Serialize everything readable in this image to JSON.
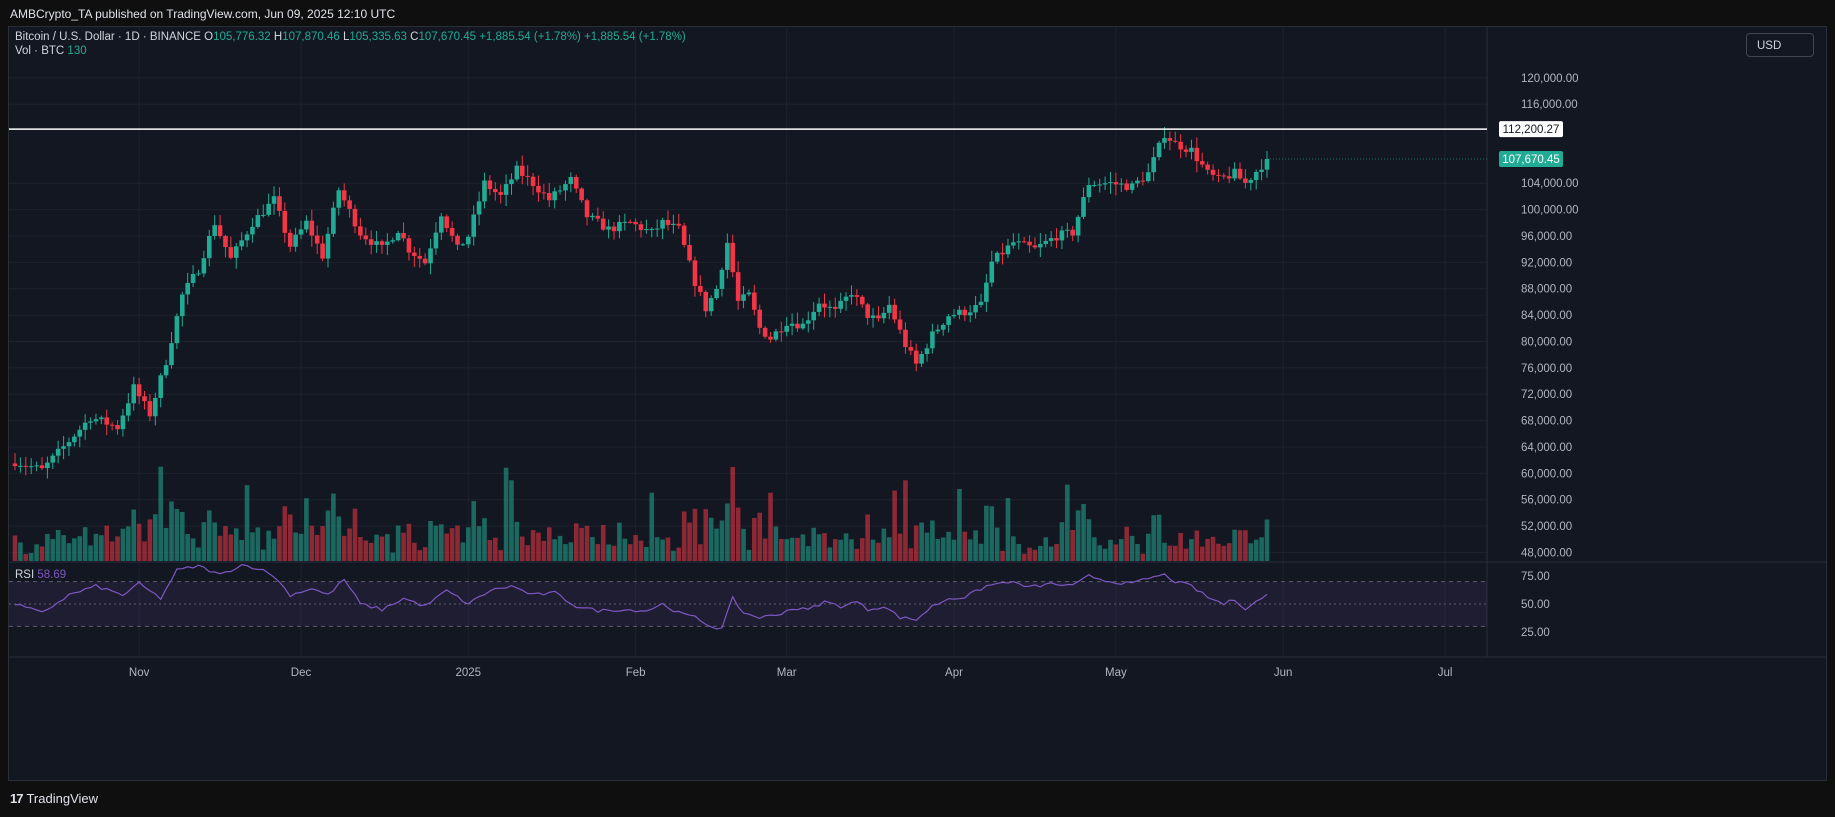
{
  "topbar": {
    "text": "AMBCrypto_TA published on TradingView.com, Jun 09, 2025 12:10 UTC"
  },
  "legend": {
    "title": "Bitcoin / U.S. Dollar · 1D · BINANCE",
    "o_label": "O",
    "o_value": "105,776.32",
    "h_label": "H",
    "h_value": "107,870.46",
    "l_label": "L",
    "l_value": "105,335.63",
    "c_label": "C",
    "c_value": "107,670.45",
    "change1": "+1,885.54 (+1.78%)",
    "change2": "+1,885.54 (+1.78%)",
    "vol_label": "Vol · BTC",
    "vol_value": "130",
    "rsi_label": "RSI",
    "rsi_value": "58.69"
  },
  "currency_button": "USD",
  "footer": {
    "logo_text": "TradingView",
    "logo_mark": "17"
  },
  "colors": {
    "up": "#22ab94",
    "down": "#f23645",
    "rsi": "#7e57c2",
    "bg": "#131722",
    "grid": "#1e222d"
  },
  "chart_data": [
    {
      "type": "candlestick",
      "title": "Bitcoin / U.S. Dollar · 1D · BINANCE",
      "y_axis_ticks": [
        120000,
        116000,
        104000,
        100000,
        96000,
        92000,
        88000,
        84000,
        80000,
        76000,
        72000,
        68000,
        64000,
        60000,
        56000,
        52000,
        48000
      ],
      "y_axis_tick_labels": [
        "120,000.00",
        "116,000.00",
        "104,000.00",
        "100,000.00",
        "96,000.00",
        "92,000.00",
        "88,000.00",
        "84,000.00",
        "80,000.00",
        "76,000.00",
        "72,000.00",
        "68,000.00",
        "64,000.00",
        "60,000.00",
        "56,000.00",
        "52,000.00",
        "48,000.00"
      ],
      "ylim": [
        46700,
        127700
      ],
      "x_axis_labels": [
        {
          "label": "Nov",
          "day": 23
        },
        {
          "label": "Dec",
          "day": 53
        },
        {
          "label": "2025",
          "day": 84
        },
        {
          "label": "Feb",
          "day": 115
        },
        {
          "label": "Mar",
          "day": 143
        },
        {
          "label": "Apr",
          "day": 174
        },
        {
          "label": "May",
          "day": 204
        },
        {
          "label": "Jun",
          "day": 235
        },
        {
          "label": "Jul",
          "day": 265
        }
      ],
      "horizontal_line": {
        "value": 112200.27,
        "label": "112,200.27",
        "color": "#ffffff"
      },
      "last_price": {
        "value": 107670.45,
        "label": "107,670.45"
      },
      "anchors": [
        [
          0,
          61800
        ],
        [
          5,
          60500
        ],
        [
          9,
          64000
        ],
        [
          14,
          68500
        ],
        [
          19,
          67000
        ],
        [
          22,
          73000
        ],
        [
          25,
          69000
        ],
        [
          28,
          77000
        ],
        [
          31,
          87000
        ],
        [
          34,
          91000
        ],
        [
          37,
          98000
        ],
        [
          40,
          92500
        ],
        [
          44,
          98000
        ],
        [
          48,
          101500
        ],
        [
          51,
          94500
        ],
        [
          54,
          98000
        ],
        [
          57,
          93000
        ],
        [
          60,
          103000
        ],
        [
          64,
          96500
        ],
        [
          68,
          94000
        ],
        [
          71,
          97000
        ],
        [
          73,
          94000
        ],
        [
          76,
          92000
        ],
        [
          79,
          99500
        ],
        [
          82,
          94000
        ],
        [
          84,
          96000
        ],
        [
          87,
          104000
        ],
        [
          90,
          102000
        ],
        [
          93,
          106000
        ],
        [
          96,
          104000
        ],
        [
          99,
          101500
        ],
        [
          103,
          104500
        ],
        [
          106,
          99000
        ],
        [
          110,
          97000
        ],
        [
          114,
          98000
        ],
        [
          118,
          96500
        ],
        [
          120,
          98000
        ],
        [
          123,
          97000
        ],
        [
          126,
          89000
        ],
        [
          128,
          85000
        ],
        [
          130,
          88000
        ],
        [
          132,
          95000
        ],
        [
          134,
          86000
        ],
        [
          136,
          87000
        ],
        [
          138,
          82000
        ],
        [
          140,
          80500
        ],
        [
          143,
          83000
        ],
        [
          146,
          82500
        ],
        [
          149,
          86000
        ],
        [
          152,
          84500
        ],
        [
          155,
          87500
        ],
        [
          158,
          84000
        ],
        [
          160,
          83000
        ],
        [
          162,
          85500
        ],
        [
          165,
          79500
        ],
        [
          167,
          76500
        ],
        [
          170,
          81000
        ],
        [
          173,
          84000
        ],
        [
          176,
          84500
        ],
        [
          179,
          85500
        ],
        [
          181,
          92000
        ],
        [
          185,
          95000
        ],
        [
          189,
          94000
        ],
        [
          193,
          96000
        ],
        [
          196,
          96500
        ],
        [
          199,
          104000
        ],
        [
          203,
          104000
        ],
        [
          207,
          103500
        ],
        [
          210,
          105500
        ],
        [
          213,
          111500
        ],
        [
          215,
          110000
        ],
        [
          218,
          109000
        ],
        [
          221,
          105500
        ],
        [
          223,
          104500
        ],
        [
          226,
          105500
        ],
        [
          228,
          104000
        ],
        [
          230,
          105800
        ],
        [
          232,
          107670.45
        ]
      ],
      "volume_panel": {
        "label": "Vol · BTC",
        "last_value": 130
      },
      "rsi_panel": {
        "label": "RSI",
        "last_value": 58.69,
        "levels": [
          75,
          50,
          25
        ],
        "level_labels": [
          "75.00",
          "50.00",
          "25.00"
        ],
        "band": [
          30,
          70
        ],
        "anchors": [
          [
            0,
            50
          ],
          [
            5,
            42
          ],
          [
            10,
            58
          ],
          [
            15,
            66
          ],
          [
            20,
            58
          ],
          [
            23,
            68
          ],
          [
            27,
            55
          ],
          [
            30,
            80
          ],
          [
            34,
            84
          ],
          [
            38,
            76
          ],
          [
            42,
            85
          ],
          [
            45,
            82
          ],
          [
            48,
            75
          ],
          [
            51,
            58
          ],
          [
            55,
            64
          ],
          [
            58,
            58
          ],
          [
            61,
            72
          ],
          [
            64,
            50
          ],
          [
            68,
            45
          ],
          [
            72,
            55
          ],
          [
            76,
            48
          ],
          [
            80,
            62
          ],
          [
            84,
            50
          ],
          [
            88,
            62
          ],
          [
            92,
            66
          ],
          [
            96,
            58
          ],
          [
            100,
            60
          ],
          [
            104,
            48
          ],
          [
            108,
            44
          ],
          [
            112,
            45
          ],
          [
            117,
            44
          ],
          [
            120,
            50
          ],
          [
            123,
            42
          ],
          [
            126,
            38
          ],
          [
            129,
            30
          ],
          [
            131,
            28
          ],
          [
            133,
            55
          ],
          [
            135,
            42
          ],
          [
            138,
            38
          ],
          [
            141,
            40
          ],
          [
            144,
            46
          ],
          [
            147,
            45
          ],
          [
            150,
            52
          ],
          [
            153,
            48
          ],
          [
            156,
            52
          ],
          [
            158,
            45
          ],
          [
            161,
            48
          ],
          [
            164,
            38
          ],
          [
            167,
            36
          ],
          [
            170,
            48
          ],
          [
            173,
            55
          ],
          [
            176,
            56
          ],
          [
            180,
            66
          ],
          [
            184,
            70
          ],
          [
            188,
            65
          ],
          [
            192,
            68
          ],
          [
            196,
            66
          ],
          [
            199,
            75
          ],
          [
            203,
            70
          ],
          [
            207,
            68
          ],
          [
            210,
            73
          ],
          [
            213,
            76
          ],
          [
            215,
            70
          ],
          [
            218,
            66
          ],
          [
            221,
            56
          ],
          [
            224,
            50
          ],
          [
            226,
            54
          ],
          [
            228,
            46
          ],
          [
            230,
            52
          ],
          [
            232,
            58.69
          ]
        ]
      }
    }
  ]
}
